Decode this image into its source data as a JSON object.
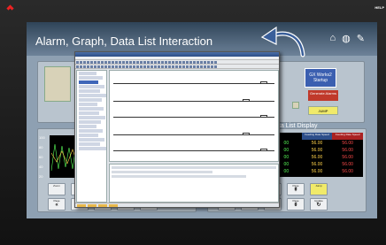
{
  "brand": {
    "logo_text": "MITSUBISHI ELECTRIC"
  },
  "help_label": "HELP",
  "screen": {
    "title": "Alarm, Graph, Data List Interaction",
    "icons": [
      "home-icon",
      "globe-icon",
      "wrench-icon"
    ]
  },
  "alarm_panel": {
    "gx_button": "GX Works2 Startup",
    "generate_button": "Generate Alarms",
    "jump_button": "JUMP"
  },
  "graph_panel": {
    "y_labels": [
      "100",
      "80",
      "60",
      "40",
      "20"
    ],
    "controls": [
      {
        "top": "Zoom",
        "bottom": "In",
        "icon": ""
      },
      {
        "top": "Zoom",
        "bottom": "Out",
        "icon": ""
      },
      {
        "top": "Cursor",
        "bottom": "",
        "icon": "←"
      },
      {
        "top": "Cursor",
        "bottom": "",
        "icon": "→"
      },
      {
        "top": "Jump",
        "bottom": "",
        "icon": ""
      },
      {
        "top": "Page",
        "bottom": "",
        "icon": "«"
      },
      {
        "top": "Page",
        "bottom": "",
        "icon": "»"
      },
      {
        "top": "Graph",
        "bottom": "",
        "icon": "‹"
      },
      {
        "top": "Graph",
        "bottom": "",
        "icon": "›"
      },
      {
        "top": "Update",
        "bottom": "",
        "icon": "↻"
      }
    ]
  },
  "data_list": {
    "title": "Data List Display",
    "headers": [
      "",
      "Feeding Rate Speed",
      "Feeding Rate Speed"
    ],
    "rows": [
      [
        "00",
        "56.00",
        "56.00"
      ],
      [
        "00",
        "56.00",
        "56.00"
      ],
      [
        "00",
        "56.00",
        "56.00"
      ],
      [
        "00",
        "56.00",
        "56.00"
      ],
      [
        "00",
        "56.00",
        "56.00"
      ]
    ],
    "controls": [
      {
        "top": "Top",
        "icon": ""
      },
      {
        "top": "Cursor",
        "icon": "↑"
      },
      {
        "top": "Scroll",
        "icon": "⌃"
      },
      {
        "top": "Page",
        "icon": "⇞"
      },
      {
        "top": "Jump",
        "icon": ""
      },
      {
        "top": "Bottom",
        "icon": ""
      },
      {
        "top": "Cursor",
        "icon": "↓"
      },
      {
        "top": "Scroll",
        "icon": "⌄"
      },
      {
        "top": "Page",
        "icon": "⇟"
      },
      {
        "top": "Update",
        "icon": "↻"
      }
    ]
  },
  "colors": {
    "accent_blue": "#3b5fb0",
    "alarm_red": "#c0392b",
    "jump_yellow": "#f0ea6a"
  }
}
